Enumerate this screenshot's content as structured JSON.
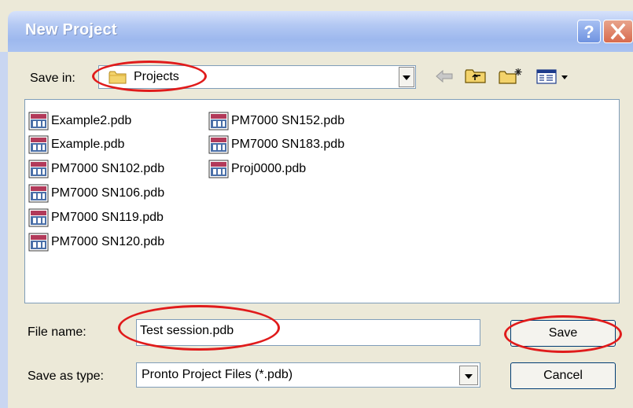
{
  "window": {
    "title": "New Project",
    "help_icon": "help-icon",
    "close_icon": "close-icon"
  },
  "save_in": {
    "label": "Save in:",
    "folder": "Projects",
    "folder_icon": "folder-icon",
    "toolbar_icons": [
      "back-arrow-icon",
      "up-folder-icon",
      "new-folder-icon",
      "view-menu-icon"
    ]
  },
  "files": {
    "icon": "pdb-file-icon",
    "column1": [
      "Example2.pdb",
      "Example.pdb",
      "PM7000 SN102.pdb",
      "PM7000 SN106.pdb",
      "PM7000 SN119.pdb",
      "PM7000 SN120.pdb"
    ],
    "column2": [
      "PM7000 SN152.pdb",
      "PM7000 SN183.pdb",
      "Proj0000.pdb"
    ]
  },
  "file_name": {
    "label": "File name:",
    "value": "Test session.pdb"
  },
  "save_as_type": {
    "label": "Save as type:",
    "value": "Pronto Project Files (*.pdb)"
  },
  "buttons": {
    "save": "Save",
    "cancel": "Cancel"
  },
  "colors": {
    "annotation": "#e01b1b",
    "title_bar": "#9db8ee",
    "dialog_bg": "#ece9d8"
  }
}
